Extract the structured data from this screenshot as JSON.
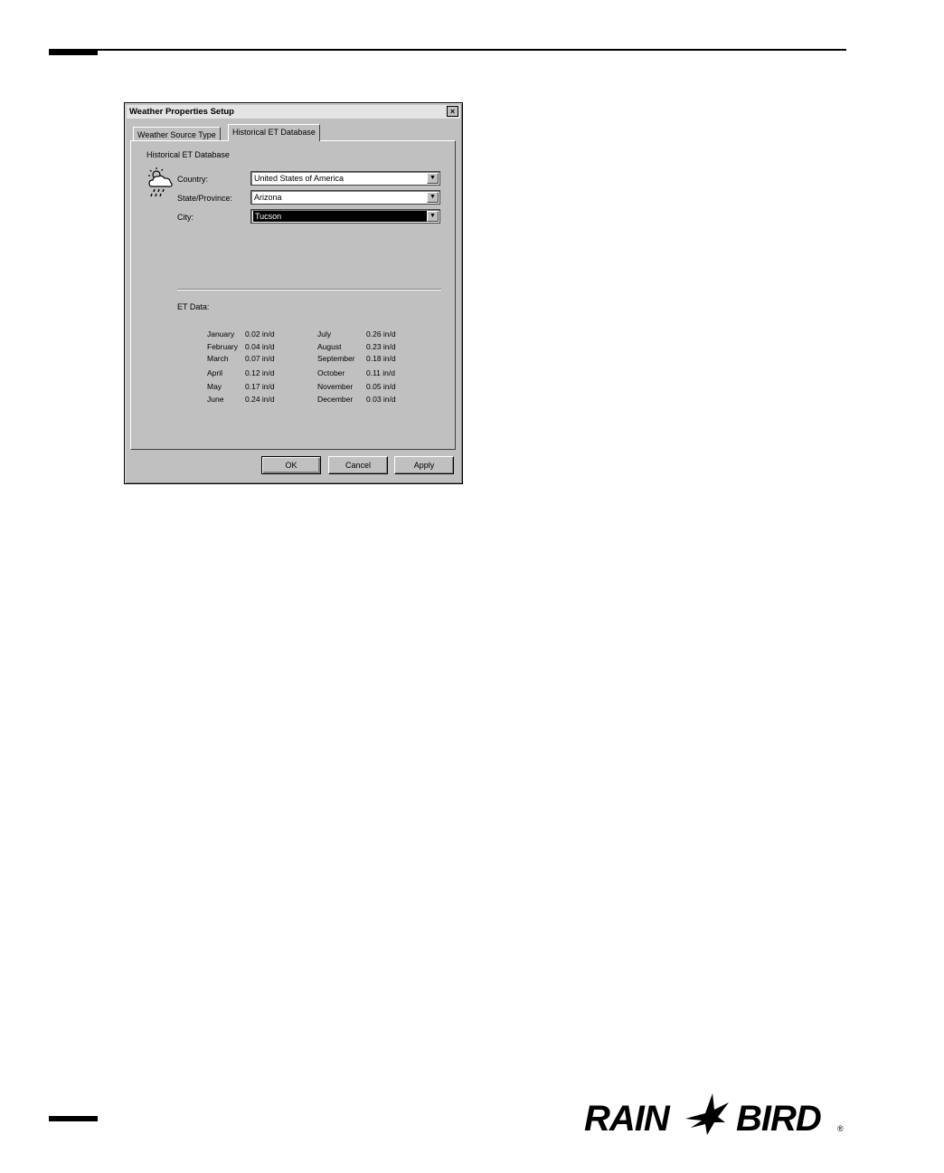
{
  "dialog": {
    "title": "Weather Properties Setup",
    "close_symbol": "×",
    "tabs": [
      {
        "label": "Weather Source Type",
        "active": false
      },
      {
        "label": "Historical ET Database",
        "active": true
      }
    ],
    "group_label": "Historical ET Database",
    "icon": "weather-cloud-rain-icon",
    "fields": {
      "country_label": "Country:",
      "country_value": "United States of America",
      "state_label": "State/Province:",
      "state_value": "Arizona",
      "city_label": "City:",
      "city_value": "Tucson"
    },
    "dropdown_arrow": "▼",
    "et_label": "ET Data:",
    "et_data": [
      {
        "month": "January",
        "value": "0.02 in/d"
      },
      {
        "month": "February",
        "value": "0.04 in/d"
      },
      {
        "month": "March",
        "value": "0.07 in/d"
      },
      {
        "month": "April",
        "value": "0.12 in/d"
      },
      {
        "month": "May",
        "value": "0.17 in/d"
      },
      {
        "month": "June",
        "value": "0.24 in/d"
      },
      {
        "month": "July",
        "value": "0.26 in/d"
      },
      {
        "month": "August",
        "value": "0.23 in/d"
      },
      {
        "month": "September",
        "value": "0.18 in/d"
      },
      {
        "month": "October",
        "value": "0.11 in/d"
      },
      {
        "month": "November",
        "value": "0.05 in/d"
      },
      {
        "month": "December",
        "value": "0.03 in/d"
      }
    ],
    "buttons": {
      "ok": "OK",
      "cancel": "Cancel",
      "apply": "Apply"
    }
  },
  "logo": {
    "text_left": "RAIN",
    "text_right": "BIRD",
    "reg": "®",
    "icon": "bird-logo-icon"
  }
}
